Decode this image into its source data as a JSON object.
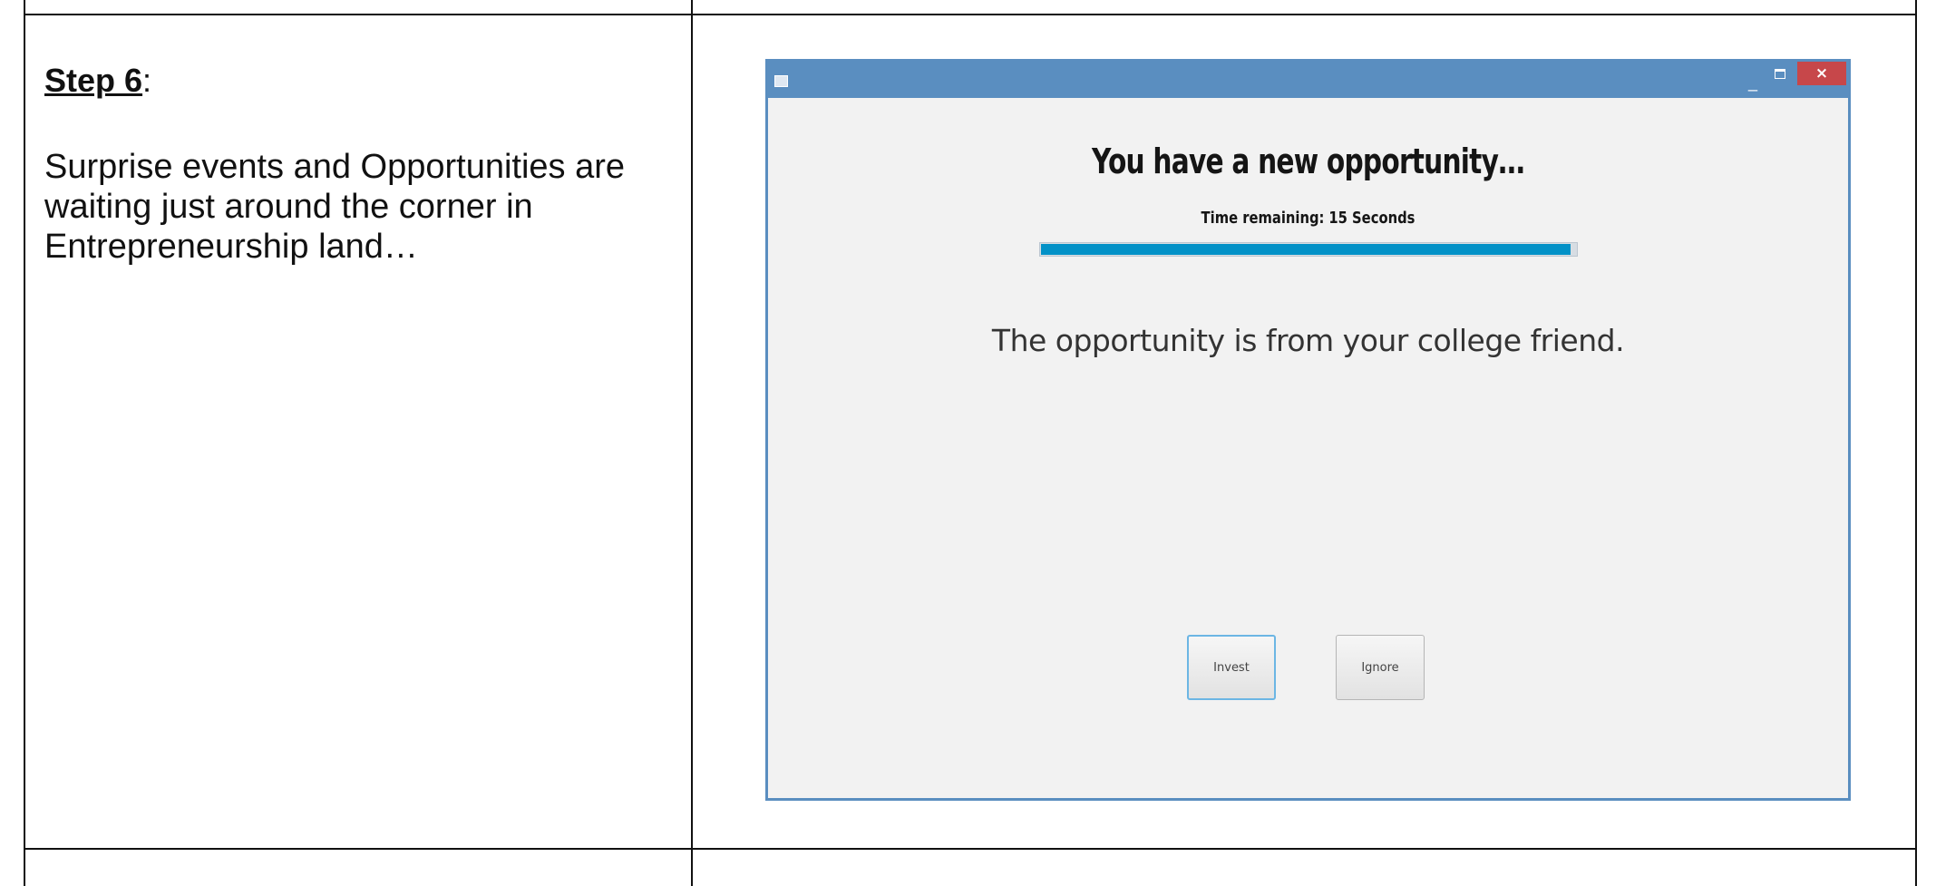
{
  "document": {
    "step_label": "Step 6",
    "step_suffix": ":",
    "description": "Surprise events and Opportunities are waiting just around the corner in Entrepreneurship land…"
  },
  "window": {
    "title": "",
    "icons": [
      "app-icon",
      "minimize-icon",
      "maximize-icon",
      "close-icon"
    ],
    "heading": "You have a new opportunity…",
    "timer_label": "Time remaining:",
    "timer_value": "15 Seconds",
    "progress_fraction": 0.99,
    "message": "The opportunity is from your college friend.",
    "buttons": {
      "invest": "Invest",
      "ignore": "Ignore"
    }
  },
  "colors": {
    "titlebar": "#5a8ec0",
    "close_button": "#c7474a",
    "progress_fill": "#0291c7",
    "window_background": "#f2f2f2",
    "focused_button_border": "#6cb6e4"
  }
}
